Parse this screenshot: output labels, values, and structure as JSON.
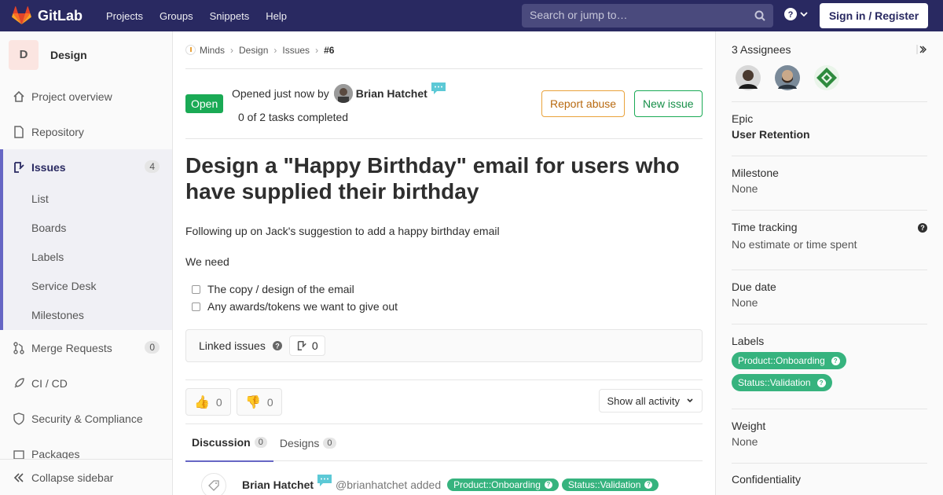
{
  "navbar": {
    "logo_text": "GitLab",
    "links": [
      "Projects",
      "Groups",
      "Snippets",
      "Help"
    ],
    "search_placeholder": "Search or jump to…",
    "signin_label": "Sign in / Register"
  },
  "sidebar": {
    "project_initial": "D",
    "project_name": "Design",
    "items": [
      {
        "label": "Project overview",
        "icon": "home-icon"
      },
      {
        "label": "Repository",
        "icon": "doc-icon"
      },
      {
        "label": "Issues",
        "icon": "issues-icon",
        "badge": "4"
      }
    ],
    "sub_items": [
      "List",
      "Boards",
      "Labels",
      "Service Desk",
      "Milestones"
    ],
    "items_after": [
      {
        "label": "Merge Requests",
        "icon": "merge-request-icon",
        "badge": "0"
      },
      {
        "label": "CI / CD",
        "icon": "rocket-icon"
      },
      {
        "label": "Security & Compliance",
        "icon": "shield-icon"
      },
      {
        "label": "Packages",
        "icon": "package-icon"
      }
    ],
    "collapse_label": "Collapse sidebar"
  },
  "breadcrumb": {
    "items": [
      "Minds",
      "Design",
      "Issues"
    ],
    "current": "#6"
  },
  "issue": {
    "status": "Open",
    "opened_text": "Opened just now by",
    "author": "Brian Hatchet",
    "tasks_text": "0 of 2 tasks completed",
    "report_label": "Report abuse",
    "new_issue_label": "New issue",
    "title": "Design a \"Happy Birthday\" email for users who have supplied their birthday",
    "desc_p1": "Following up on Jack's suggestion to add a happy birthday email",
    "desc_p2": "We need",
    "tasks": [
      "The copy / design of the email",
      "Any awards/tokens we want to give out"
    ],
    "linked_label": "Linked issues",
    "linked_count": "0",
    "thumbs_up": "0",
    "thumbs_down": "0",
    "activity_label": "Show all activity",
    "tabs": [
      {
        "label": "Discussion",
        "count": "0"
      },
      {
        "label": "Designs",
        "count": "0"
      }
    ],
    "note": {
      "author": "Brian Hatchet",
      "handle": "@brianhatchet added",
      "labels": [
        "Product::Onboarding",
        "Status::Validation"
      ]
    }
  },
  "right_sidebar": {
    "assignees_title": "3 Assignees",
    "epic_title": "Epic",
    "epic_value": "User Retention",
    "milestone_title": "Milestone",
    "milestone_value": "None",
    "time_title": "Time tracking",
    "time_value": "No estimate or time spent",
    "due_title": "Due date",
    "due_value": "None",
    "labels_title": "Labels",
    "labels": [
      "Product::Onboarding",
      "Status::Validation"
    ],
    "weight_title": "Weight",
    "weight_value": "None",
    "confidentiality_title": "Confidentiality"
  },
  "colors": {
    "navbar": "#292961",
    "open_status": "#1aaa55",
    "scoped_label": "#36b37e",
    "active_accent": "#6666c4"
  }
}
